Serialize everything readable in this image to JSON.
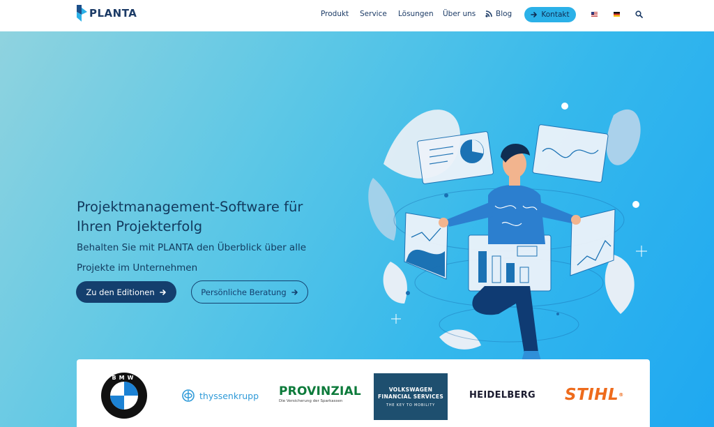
{
  "brand": {
    "name": "PLANTA"
  },
  "nav": {
    "items": [
      {
        "label": "Produkt"
      },
      {
        "label": "Service"
      },
      {
        "label": "Lösungen"
      },
      {
        "label": "Über uns"
      },
      {
        "label": "Blog"
      }
    ],
    "contact_label": "Kontakt",
    "languages": [
      "us-flag-icon",
      "de-flag-icon"
    ]
  },
  "hero": {
    "title": "Projektmanagement-Software für Ihren Projekterfolg",
    "subtitle": "Behalten Sie mit PLANTA den Überblick über alle Projekte im Unternehmen",
    "primary_cta": "Zu den Editionen",
    "secondary_cta": "Persönliche Beratung"
  },
  "clients": {
    "bmw": "BMW",
    "thyssenkrupp": "thyssenkrupp",
    "provinzial": {
      "name": "PROVINZIAL",
      "tagline": "Die Versicherung der Sparkassen"
    },
    "vw": {
      "line1": "VOLKSWAGEN",
      "line2": "FINANCIAL SERVICES",
      "line3": "THE KEY TO MOBILITY"
    },
    "heidelberg": "HEIDELBERG",
    "stihl": "STIHL"
  },
  "colors": {
    "navy": "#143f6e",
    "accent": "#2bb1e8",
    "hero_start": "#8fd3df",
    "hero_end": "#1fa8f1"
  }
}
